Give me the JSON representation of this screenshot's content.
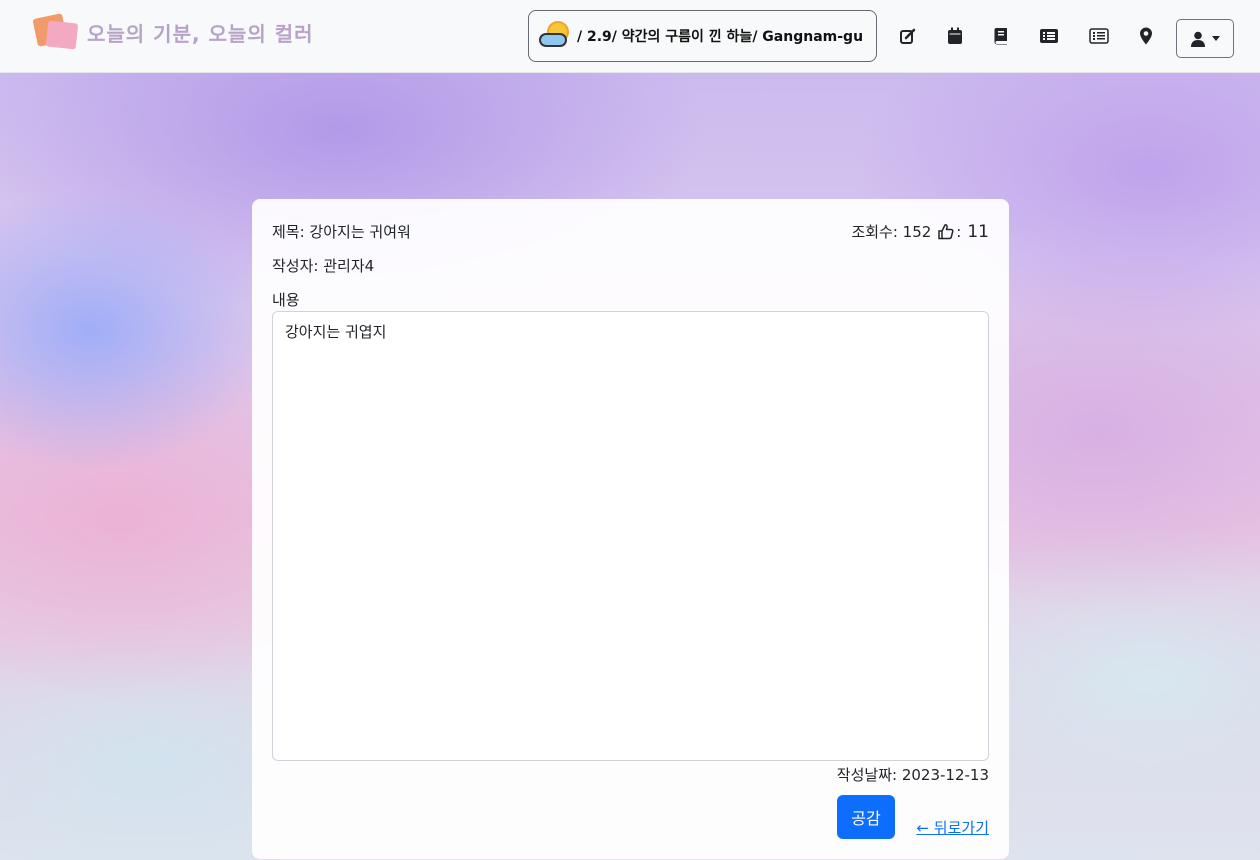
{
  "navbar": {
    "brand_text": "오늘의 기분, 오늘의 컬러",
    "weather_text": "/ 2.9/ 약간의 구름이 낀 하늘/ Gangnam-gu",
    "icons": [
      "edit-icon",
      "calendar-icon",
      "book-icon",
      "list-alt-icon",
      "list-icon",
      "map-marker-icon",
      "user-icon"
    ]
  },
  "post": {
    "title_text": "제목: 강아지는 귀여워",
    "views_text": "조회수: 152",
    "likes_sep": ":",
    "likes_count": "11",
    "author_text": "작성자: 관리자4",
    "content_label": "내용",
    "content_value": "강아지는 귀엽지",
    "date_text": "작성날짜: 2023-12-13",
    "like_button_label": "공감",
    "back_link_label": "← 뒤로가기"
  },
  "colors": {
    "primary": "#0d6efd",
    "navbar_bg": "#f8f9fa",
    "brand_text": "#b8a3c8"
  }
}
